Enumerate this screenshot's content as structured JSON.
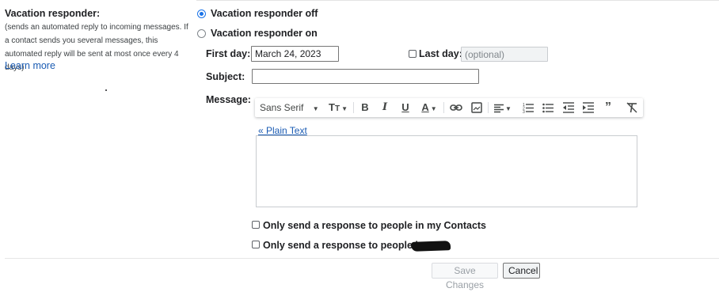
{
  "left": {
    "title": "Vacation responder:",
    "description": "(sends an automated reply to incoming messages. If a contact sends you several messages, this automated reply will be sent at most once every 4 days)",
    "learn_more": "Learn more"
  },
  "responder": {
    "off_label": "Vacation responder off",
    "on_label": "Vacation responder on",
    "selected": "off"
  },
  "first_day": {
    "label": "First day:",
    "value": "March 24, 2023"
  },
  "last_day": {
    "label": "Last day:",
    "placeholder": "(optional)",
    "checked": false
  },
  "subject": {
    "label": "Subject:",
    "value": ""
  },
  "message": {
    "label": "Message:",
    "font_name": "Sans Serif",
    "plain_text_link": "« Plain Text",
    "body": ""
  },
  "toolbar_icons": [
    "font-size-icon",
    "bold-icon",
    "italic-icon",
    "underline-icon",
    "text-color-icon",
    "link-icon",
    "image-icon",
    "align-icon",
    "numbered-list-icon",
    "bulleted-list-icon",
    "indent-less-icon",
    "indent-more-icon",
    "quote-icon",
    "remove-formatting-icon"
  ],
  "options": {
    "contacts_only": "Only send a response to people in my Contacts",
    "domain_only": "Only send a response to people in"
  },
  "buttons": {
    "save": "Save Changes",
    "cancel": "Cancel"
  },
  "colors": {
    "accent": "#1a73e8",
    "link": "#1a5bb3",
    "text": "#202124"
  }
}
